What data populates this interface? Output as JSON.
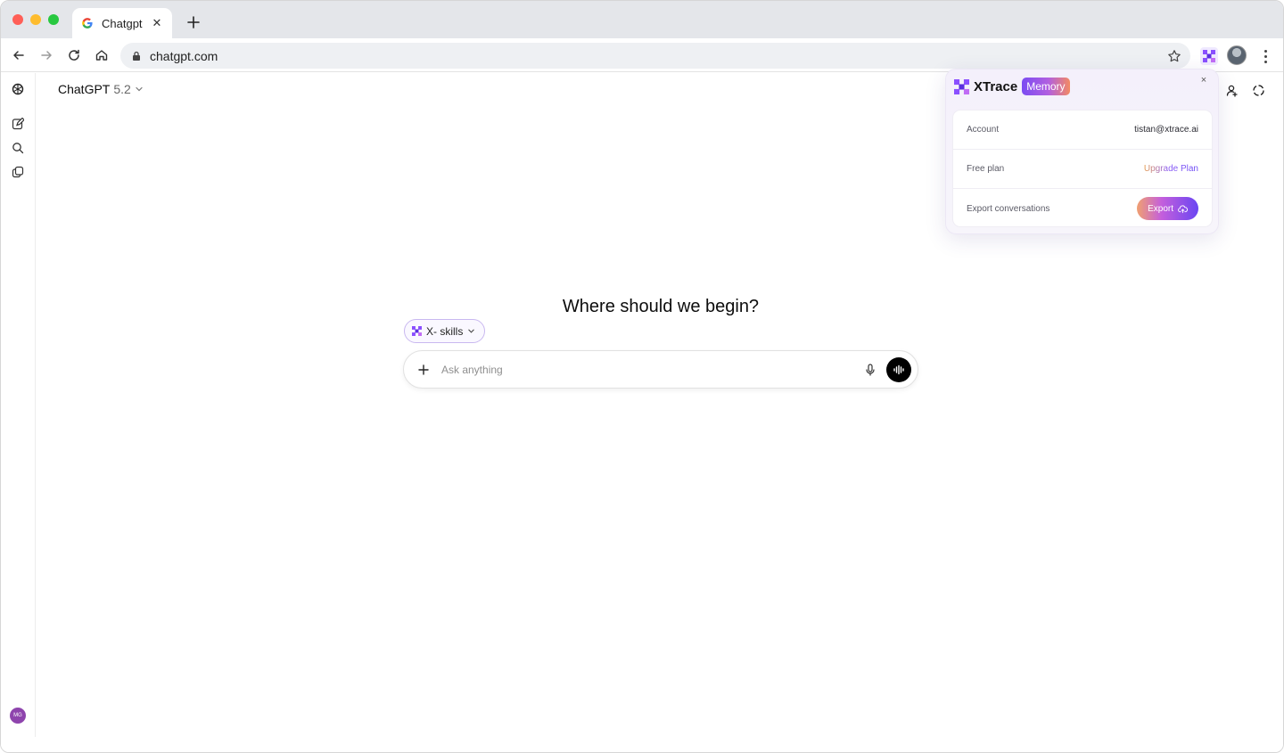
{
  "browser": {
    "tab": {
      "title": "Chatgpt",
      "close_glyph": "✕"
    },
    "new_tab_icon": "plus-icon",
    "address": {
      "url": "chatgpt.com"
    }
  },
  "chat": {
    "model_name": "ChatGPT",
    "model_version": "5.2",
    "hero_title": "Where should we begin?",
    "skills_chip_label": "X- skills",
    "composer_placeholder": "Ask anything",
    "user_initials": "MG"
  },
  "xtrace": {
    "brand": "XTrace",
    "badge": "Memory",
    "close_glyph": "×",
    "account_label": "Account",
    "account_value": "tistan@xtrace.ai",
    "plan_label": "Free plan",
    "upgrade_label": "Upgrade Plan",
    "export_label": "Export conversations",
    "export_button": "Export"
  },
  "colors": {
    "accent_purple": "#7b4cf2",
    "accent_orange": "#f38a63",
    "tab_strip_bg": "#e4e6ea"
  }
}
